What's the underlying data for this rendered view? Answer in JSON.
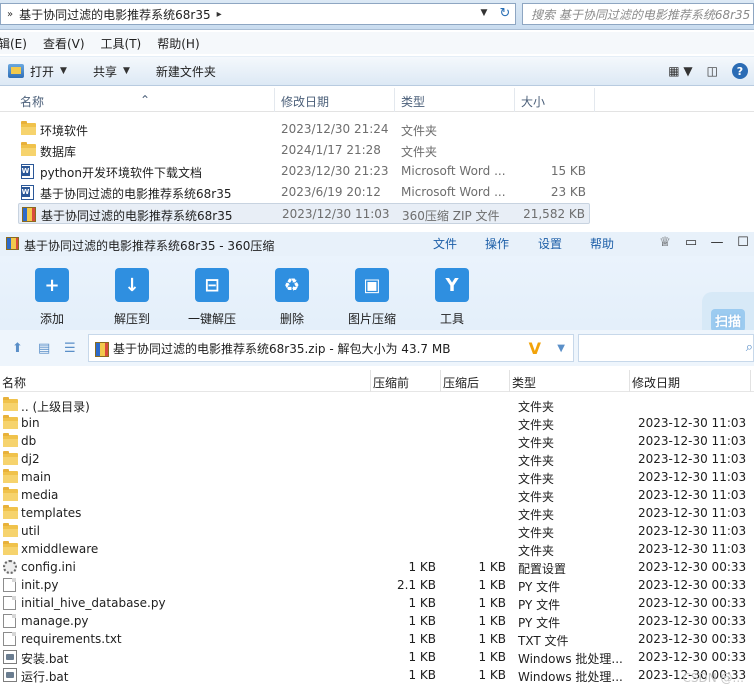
{
  "explorer": {
    "breadcrumbs": [
      "基于协同过滤的电影推荐系统68r35"
    ],
    "search_placeholder": "搜索 基于协同过滤的电影推荐系统68r35",
    "menu": [
      "编辑(E)",
      "查看(V)",
      "工具(T)",
      "帮助(H)"
    ],
    "commands": {
      "open": "打开",
      "share": "共享",
      "new_folder": "新建文件夹"
    },
    "columns": {
      "name": "名称",
      "date": "修改日期",
      "type": "类型",
      "size": "大小"
    },
    "rows": [
      {
        "name": "环境软件",
        "date": "2023/12/30 21:24",
        "type": "文件夹",
        "size": "",
        "icon": "folder-icon"
      },
      {
        "name": "数据库",
        "date": "2024/1/17 21:28",
        "type": "文件夹",
        "size": "",
        "icon": "folder-icon"
      },
      {
        "name": "python开发环境软件下载文档",
        "date": "2023/12/30 21:23",
        "type": "Microsoft Word ...",
        "size": "15 KB",
        "icon": "word-doc-icon"
      },
      {
        "name": "基于协同过滤的电影推荐系统68r35",
        "date": "2023/6/19 20:12",
        "type": "Microsoft Word ...",
        "size": "23 KB",
        "icon": "word-doc-icon"
      },
      {
        "name": "基于协同过滤的电影推荐系统68r35",
        "date": "2023/12/30 11:03",
        "type": "360压缩 ZIP 文件",
        "size": "21,582 KB",
        "icon": "zip-archive-icon",
        "selected": true
      }
    ]
  },
  "zip": {
    "title": "基于协同过滤的电影推荐系统68r35 - 360压缩",
    "menu": [
      "文件",
      "操作",
      "设置",
      "帮助"
    ],
    "tools": [
      {
        "label": "添加",
        "icon": "add-icon",
        "color": "#2f8fe0"
      },
      {
        "label": "解压到",
        "icon": "extract-to-icon",
        "color": "#2f8fe0"
      },
      {
        "label": "一键解压",
        "icon": "one-click-extract-icon",
        "color": "#2f8fe0"
      },
      {
        "label": "删除",
        "icon": "delete-icon",
        "color": "#2f8fe0"
      },
      {
        "label": "图片压缩",
        "icon": "image-compress-icon",
        "color": "#2f8fe0"
      },
      {
        "label": "工具",
        "icon": "tools-icon",
        "color": "#2f8fe0"
      }
    ],
    "scan_label": "扫描",
    "path_text": "基于协同过滤的电影推荐系统68r35.zip - 解包大小为 43.7 MB",
    "columns": {
      "name": "名称",
      "compressed_before": "压缩前",
      "compressed_after": "压缩后",
      "type": "类型",
      "date": "修改日期"
    },
    "rows": [
      {
        "name": ".. (上级目录)",
        "before": "",
        "after": "",
        "type": "文件夹",
        "date": "",
        "icon": "folder-icon"
      },
      {
        "name": "bin",
        "before": "",
        "after": "",
        "type": "文件夹",
        "date": "2023-12-30 11:03",
        "icon": "folder-icon"
      },
      {
        "name": "db",
        "before": "",
        "after": "",
        "type": "文件夹",
        "date": "2023-12-30 11:03",
        "icon": "folder-icon"
      },
      {
        "name": "dj2",
        "before": "",
        "after": "",
        "type": "文件夹",
        "date": "2023-12-30 11:03",
        "icon": "folder-icon"
      },
      {
        "name": "main",
        "before": "",
        "after": "",
        "type": "文件夹",
        "date": "2023-12-30 11:03",
        "icon": "folder-icon"
      },
      {
        "name": "media",
        "before": "",
        "after": "",
        "type": "文件夹",
        "date": "2023-12-30 11:03",
        "icon": "folder-icon"
      },
      {
        "name": "templates",
        "before": "",
        "after": "",
        "type": "文件夹",
        "date": "2023-12-30 11:03",
        "icon": "folder-icon"
      },
      {
        "name": "util",
        "before": "",
        "after": "",
        "type": "文件夹",
        "date": "2023-12-30 11:03",
        "icon": "folder-icon"
      },
      {
        "name": "xmiddleware",
        "before": "",
        "after": "",
        "type": "文件夹",
        "date": "2023-12-30 11:03",
        "icon": "folder-icon"
      },
      {
        "name": "config.ini",
        "before": "1 KB",
        "after": "1 KB",
        "type": "配置设置",
        "date": "2023-12-30 00:33",
        "icon": "config-file-icon"
      },
      {
        "name": "init.py",
        "before": "2.1 KB",
        "after": "1 KB",
        "type": "PY 文件",
        "date": "2023-12-30 00:33",
        "icon": "file-icon"
      },
      {
        "name": "initial_hive_database.py",
        "before": "1 KB",
        "after": "1 KB",
        "type": "PY 文件",
        "date": "2023-12-30 00:33",
        "icon": "file-icon"
      },
      {
        "name": "manage.py",
        "before": "1 KB",
        "after": "1 KB",
        "type": "PY 文件",
        "date": "2023-12-30 00:33",
        "icon": "file-icon"
      },
      {
        "name": "requirements.txt",
        "before": "1 KB",
        "after": "1 KB",
        "type": "TXT 文件",
        "date": "2023-12-30 00:33",
        "icon": "file-icon"
      },
      {
        "name": "安装.bat",
        "before": "1 KB",
        "after": "1 KB",
        "type": "Windows 批处理...",
        "date": "2023-12-30 00:33",
        "icon": "batch-file-icon"
      },
      {
        "name": "运行.bat",
        "before": "1 KB",
        "after": "1 KB",
        "type": "Windows 批处理...",
        "date": "2023-12-30 00:33",
        "icon": "batch-file-icon"
      }
    ]
  },
  "watermark": "CSDN @..."
}
